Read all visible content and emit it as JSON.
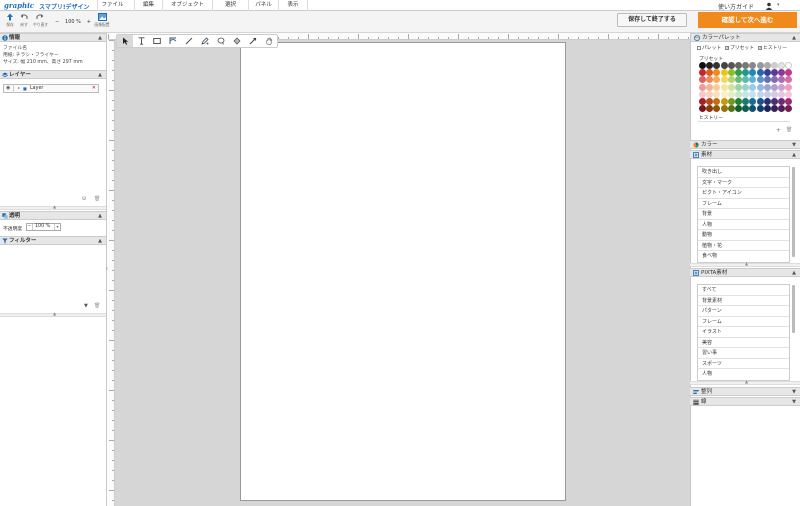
{
  "app": {
    "logo": "graphic",
    "title": "スマプリ!デザイン",
    "menu": [
      "ファイル",
      "編集",
      "オブジェクト",
      "選択",
      "パネル",
      "表示"
    ],
    "help": "使い方ガイド"
  },
  "toolbar": {
    "buttons": [
      "保存",
      "戻す",
      "やり直す",
      "画像配置"
    ],
    "zoom": "100 %",
    "zoom_minus": "−",
    "zoom_plus": "+",
    "save_exit": "保存して終了する",
    "confirm_next": "確認して次へ進む"
  },
  "info_panel": {
    "title": "情報",
    "lines": [
      "ファイル名",
      "用紙: チラシ・フライヤー",
      "サイズ: 幅 210 mm、高さ 297 mm"
    ]
  },
  "layers_panel": {
    "title": "レイヤー",
    "layer_name": "Layer"
  },
  "opacity_panel": {
    "title": "透明",
    "label": "不透明度",
    "value": "100 %"
  },
  "filter_panel": {
    "title": "フィルター"
  },
  "color_palette": {
    "title": "カラーパレット",
    "checks": [
      "パレット",
      "プリセット",
      "ヒストリー"
    ],
    "checked": [
      false,
      true,
      true
    ],
    "preset_label": "プリセット",
    "history_label": "ヒストリー",
    "swatch_colors": [
      [
        "#111111",
        "#222222",
        "#333333",
        "#444444",
        "#555555",
        "#666666",
        "#777777",
        "#888888",
        "#999999",
        "#aaaaaa",
        "#cccccc",
        "#e4e4e4",
        "#ffffff"
      ],
      [
        "#c0282b",
        "#e05a20",
        "#f08a1c",
        "#f3c21a",
        "#8cbd2e",
        "#2e9e48",
        "#20998a",
        "#1f88b8",
        "#2566b0",
        "#2f3f96",
        "#5c3a93",
        "#8a3796",
        "#c2378a"
      ],
      [
        "#e06163",
        "#f08a5c",
        "#f5ad5b",
        "#f7d65c",
        "#b3d46a",
        "#68bb78",
        "#5cbcaf",
        "#5fb0d8",
        "#5f8fcc",
        "#6370b5",
        "#8a6bb3",
        "#b06bb5",
        "#db6aa8"
      ],
      [
        "#ee9a9b",
        "#f5b394",
        "#f8cb95",
        "#f9e49a",
        "#cfe39e",
        "#9cd3a6",
        "#97d4cb",
        "#99cbe6",
        "#99b4de",
        "#9da5d0",
        "#b39fcf",
        "#cea0d0",
        "#ea9fc5"
      ],
      [
        "#f6c8c8",
        "#f9d2bf",
        "#fbe0c0",
        "#fbefc4",
        "#e3efc6",
        "#c6e6cb",
        "#c3e6e0",
        "#c4e0f0",
        "#c4d3ec",
        "#c7cbe5",
        "#d4c8e5",
        "#e3c8e5",
        "#f4c8dd"
      ],
      [
        "#a32023",
        "#b84a18",
        "#c06e12",
        "#c49b10",
        "#6e9a22",
        "#237e38",
        "#197b6e",
        "#176d94",
        "#1c518d",
        "#243277",
        "#482e75",
        "#6d2b77",
        "#9b2b6e"
      ],
      [
        "#7a1518",
        "#8a3611",
        "#92520c",
        "#94740b",
        "#537417",
        "#195e29",
        "#125c52",
        "#115270",
        "#153d6a",
        "#1b2559",
        "#362257",
        "#521f59",
        "#741f52"
      ]
    ]
  },
  "color_panel": {
    "title": "カラー"
  },
  "materials_panel": {
    "title": "素材",
    "items": [
      "吹き出し",
      "文字・マーク",
      "ピクト・アイコン",
      "フレーム",
      "背景",
      "人物",
      "動物",
      "植物・花",
      "食べ物"
    ]
  },
  "pixta_panel": {
    "title": "PIXTA素材",
    "items": [
      "すべて",
      "背景素材",
      "パターン",
      "フレーム",
      "イラスト",
      "美容",
      "習い事",
      "スポーツ",
      "人物"
    ]
  },
  "align_panel": {
    "title": "整列"
  },
  "line_panel": {
    "title": "線"
  },
  "colors": {
    "accent": "#f08a1c",
    "brand_blue": "#1d6fb8",
    "canvas_bg": "#d6d6d6"
  }
}
